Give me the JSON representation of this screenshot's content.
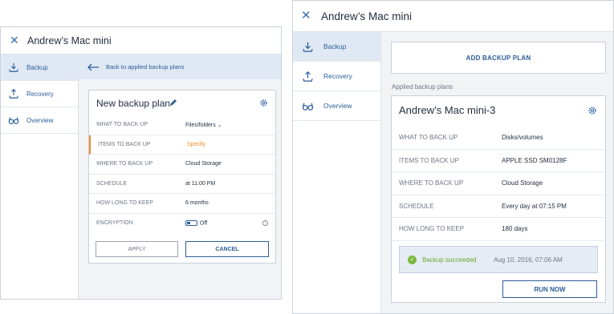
{
  "colors": {
    "accent": "#2b5d99",
    "active_nav_bg": "#dfe8f3",
    "warning": "#f08a24",
    "success": "#7fb944",
    "main_bg": "#f1f3f5"
  },
  "left_window": {
    "title": "Andrew’s Mac mini",
    "nav": [
      {
        "label": "Backup",
        "icon": "backup-icon",
        "active": true
      },
      {
        "label": "Recovery",
        "icon": "recovery-icon",
        "active": false
      },
      {
        "label": "Overview",
        "icon": "overview-icon",
        "active": false
      }
    ],
    "back_link": "Back to applied backup plans",
    "plan": {
      "title": "New backup plan",
      "rows": [
        {
          "label": "WHAT TO BACK UP",
          "value": "Files/folders"
        },
        {
          "label": "ITEMS TO BACK UP",
          "value": "Specify"
        },
        {
          "label": "WHERE TO BACK UP",
          "value": "Cloud Storage"
        },
        {
          "label": "SCHEDULE",
          "value": "at 11:00 PM"
        },
        {
          "label": "HOW LONG TO KEEP",
          "value": "6 months"
        },
        {
          "label": "ENCRYPTION",
          "value": "Off"
        }
      ],
      "apply_label": "APPLY",
      "cancel_label": "CANCEL"
    }
  },
  "right_window": {
    "title": "Andrew’s Mac mini",
    "nav": [
      {
        "label": "Backup",
        "icon": "backup-icon",
        "active": true
      },
      {
        "label": "Recovery",
        "icon": "recovery-icon",
        "active": false
      },
      {
        "label": "Overview",
        "icon": "overview-icon",
        "active": false
      }
    ],
    "add_plan_label": "ADD BACKUP PLAN",
    "applied_heading": "Applied backup plans",
    "plan": {
      "title": "Andrew’s Mac mini-3",
      "rows": [
        {
          "label": "WHAT TO BACK UP",
          "value": "Disks/volumes"
        },
        {
          "label": "ITEMS TO BACK UP",
          "value": "APPLE SSD SM0128F"
        },
        {
          "label": "WHERE TO BACK UP",
          "value": "Cloud Storage"
        },
        {
          "label": "SCHEDULE",
          "value": "Every day at 07:15 PM"
        },
        {
          "label": "HOW LONG TO KEEP",
          "value": "180 days"
        }
      ],
      "status_text": "Backup succeeded",
      "status_time": "Aug 10, 2016, 07:06 AM",
      "run_now_label": "RUN NOW"
    }
  }
}
